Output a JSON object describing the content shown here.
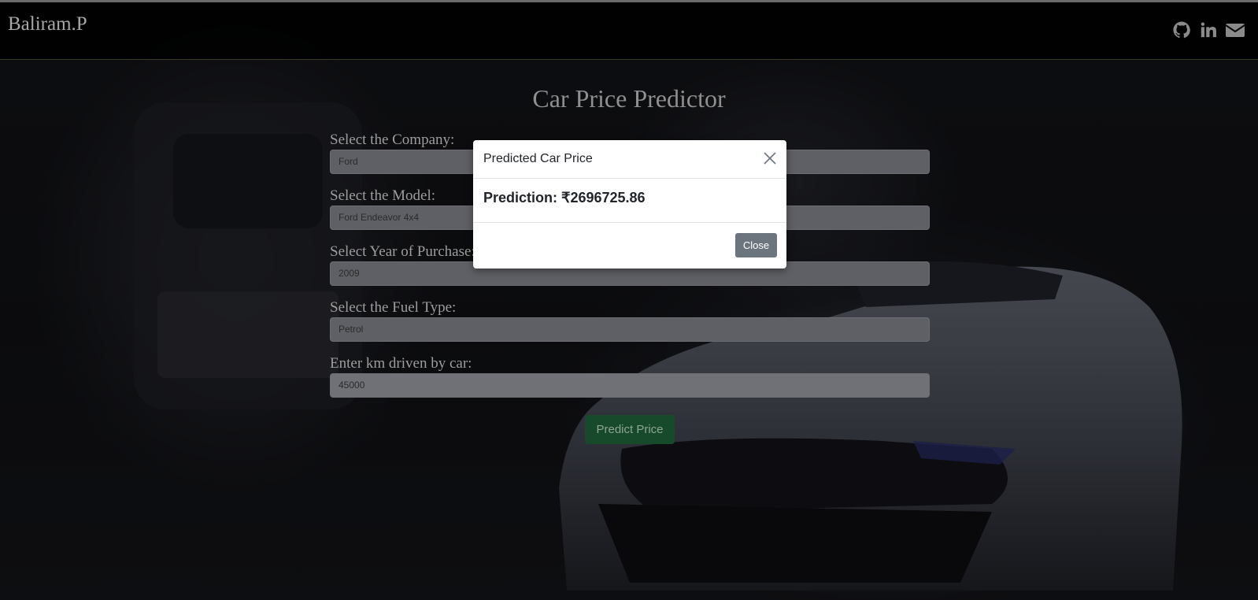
{
  "header": {
    "brand": "Baliram.P",
    "icons": [
      "github-icon",
      "linkedin-icon",
      "email-icon"
    ]
  },
  "main": {
    "title": "Car Price Predictor",
    "fields": [
      {
        "label": "Select the Company:",
        "value": "Ford"
      },
      {
        "label": "Select the Model:",
        "value": "Ford Endeavor 4x4"
      },
      {
        "label": "Select Year of Purchase:",
        "value": "2009"
      },
      {
        "label": "Select the Fuel Type:",
        "value": "Petrol"
      },
      {
        "label": "Enter km driven by car:",
        "value": "45000"
      }
    ],
    "predict_button": "Predict Price"
  },
  "modal": {
    "title": "Predicted Car Price",
    "prediction": "Prediction: ₹2696725.86",
    "close_button": "Close"
  },
  "colors": {
    "predict_button_bg": "#174a2b",
    "close_button_bg": "#6c757d"
  }
}
